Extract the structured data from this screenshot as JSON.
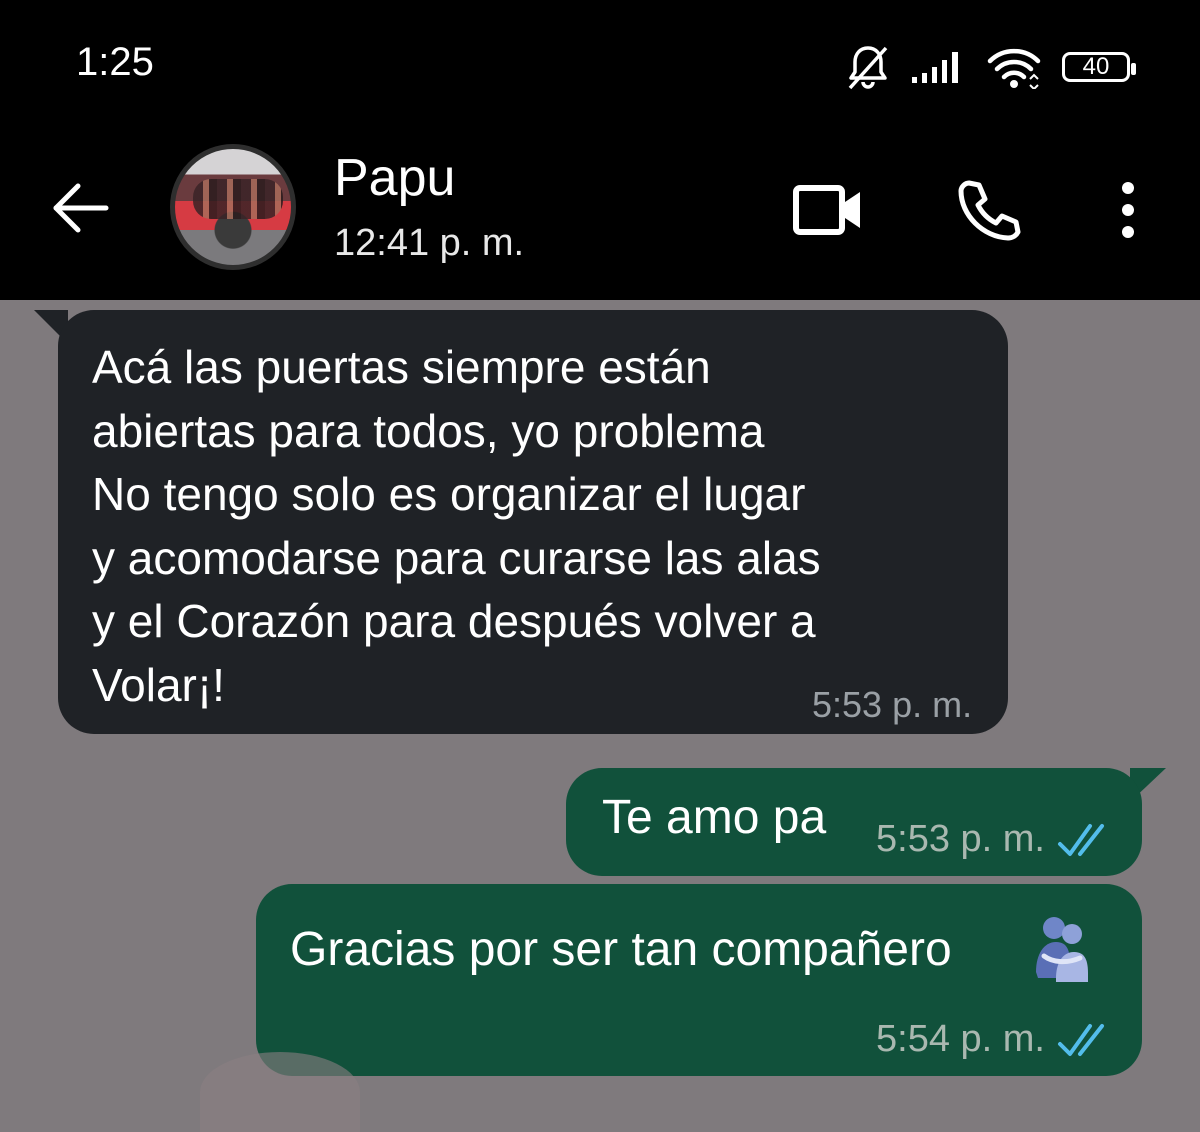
{
  "status_bar": {
    "time": "1:25",
    "battery": "40",
    "icons": [
      "notifications-off-icon",
      "signal-icon",
      "wifi-icon",
      "battery-icon"
    ]
  },
  "header": {
    "contact_name": "Papu",
    "last_seen": "12:41 p. m.",
    "icons": [
      "back-arrow-icon",
      "video-call-icon",
      "phone-icon",
      "more-options-icon"
    ]
  },
  "messages": [
    {
      "direction": "incoming",
      "text": "Acá las puertas siempre están\nabiertas para todos, yo problema\nNo tengo solo es organizar el lugar\ny acomodarse para curarse las alas\ny el Corazón para después volver a\nVolar¡!",
      "time": "5:53 p. m."
    },
    {
      "direction": "outgoing",
      "text": "Te amo pa",
      "time": "5:53 p. m.",
      "status": "read"
    },
    {
      "direction": "outgoing",
      "text": "Gracias por ser tan compañero",
      "emoji": "hug-emoji",
      "time": "5:54 p. m.",
      "status": "read"
    }
  ],
  "colors": {
    "background": "#7f7a7d",
    "header": "#000000",
    "incoming_bubble": "#1f2226",
    "outgoing_bubble": "#11513b",
    "read_ticks": "#53bdeb"
  }
}
